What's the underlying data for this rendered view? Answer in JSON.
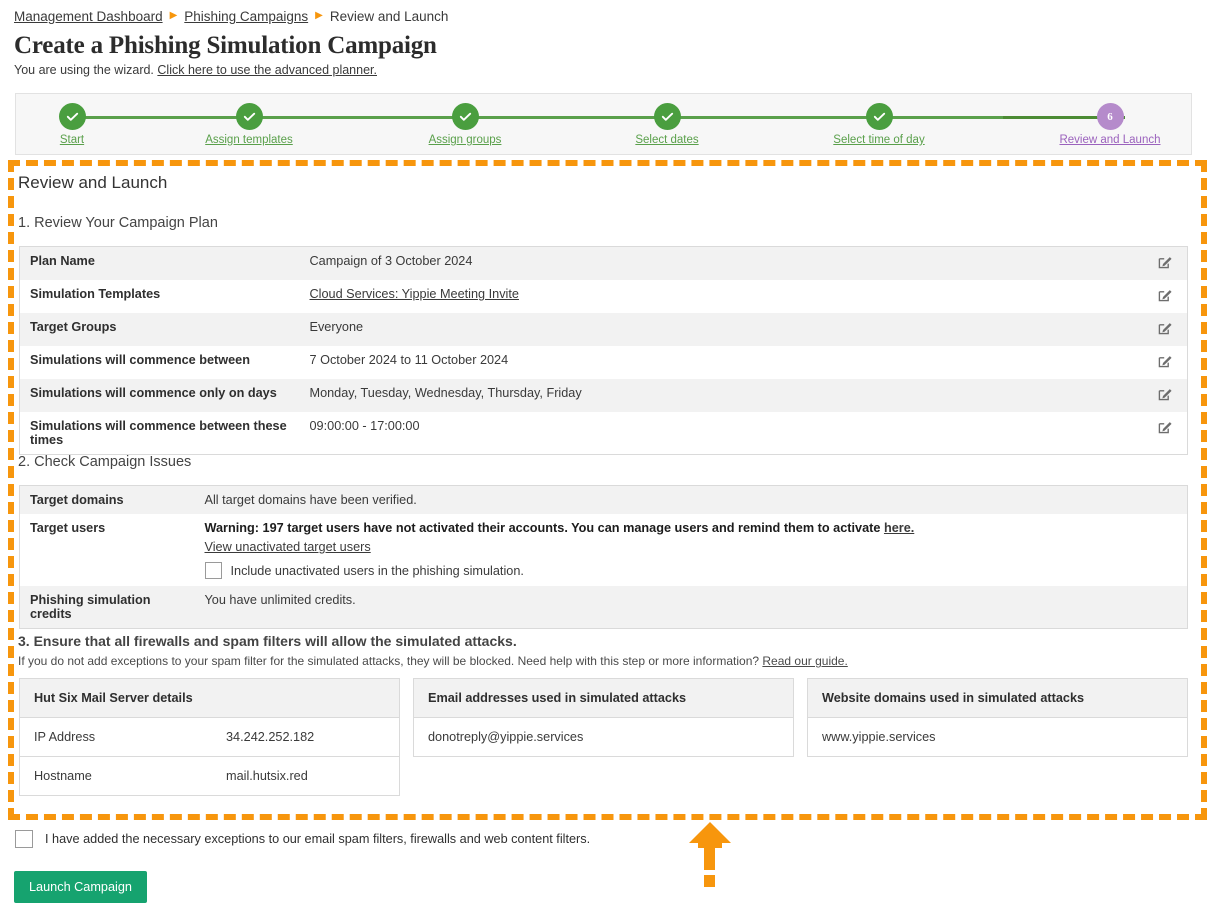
{
  "breadcrumb": {
    "items": [
      {
        "label": "Management Dashboard",
        "link": true
      },
      {
        "label": "Phishing Campaigns",
        "link": true
      },
      {
        "label": "Review and Launch",
        "link": false
      }
    ],
    "separator": "▶"
  },
  "header": {
    "title": "Create a Phishing Simulation Campaign",
    "subtitle_prefix": "You are using the wizard. ",
    "subtitle_link": "Click here to use the advanced planner."
  },
  "stepper": {
    "steps": [
      {
        "label": "Start",
        "state": "done",
        "marker": "✓"
      },
      {
        "label": "Assign templates",
        "state": "done",
        "marker": "✓"
      },
      {
        "label": "Assign groups",
        "state": "done",
        "marker": "✓"
      },
      {
        "label": "Select dates",
        "state": "done",
        "marker": "✓"
      },
      {
        "label": "Select time of day",
        "state": "done",
        "marker": "✓"
      },
      {
        "label": "Review and Launch",
        "state": "current",
        "marker": "6"
      }
    ],
    "done_color": "#4a9e3f",
    "current_color": "#b58bcb",
    "line_color": "#5aa04b"
  },
  "main": {
    "heading": "Review and Launch",
    "section1": {
      "title": "1. Review Your Campaign Plan",
      "rows": [
        {
          "label": "Plan Name",
          "value": "Campaign of 3 October 2024",
          "is_link": false,
          "edit_icon": "edit-pencil-icon"
        },
        {
          "label": "Simulation Templates",
          "value": "Cloud Services: Yippie Meeting Invite",
          "is_link": true,
          "edit_icon": "edit-pencil-icon"
        },
        {
          "label": "Target Groups",
          "value": "Everyone",
          "is_link": false,
          "edit_icon": "edit-pencil-icon"
        },
        {
          "label": "Simulations will commence between",
          "value": "7 October 2024 to 11 October 2024",
          "is_link": false,
          "edit_icon": "edit-pencil-icon"
        },
        {
          "label": "Simulations will commence only on days",
          "value": "Monday, Tuesday, Wednesday, Thursday, Friday",
          "is_link": false,
          "edit_icon": "edit-pencil-icon"
        },
        {
          "label": "Simulations will commence between these times",
          "value": "09:00:00 - 17:00:00",
          "is_link": false,
          "edit_icon": "edit-pencil-icon"
        }
      ]
    },
    "section2": {
      "title": "2. Check Campaign Issues",
      "domains_label": "Target domains",
      "domains_value": "All target domains have been verified.",
      "users_label": "Target users",
      "users_warning": "Warning: 197 target users have not activated their accounts. You can manage users and remind them to activate ",
      "users_warning_link": "here.",
      "view_unactivated_link": "View unactivated target users",
      "include_unactivated_label": "Include unactivated users in the phishing simulation.",
      "include_unactivated_checked": false,
      "credits_label": "Phishing simulation credits",
      "credits_value": "You have unlimited credits."
    },
    "section3": {
      "title": "3. Ensure that all firewalls and spam filters will allow the simulated attacks.",
      "note_prefix": "If you do not add exceptions to your spam filter for the simulated attacks, they will be blocked. Need help with this step or more information? ",
      "note_link": "Read our guide.",
      "cards": [
        {
          "heading": "Hut Six Mail Server details",
          "rows": [
            {
              "key": "IP Address",
              "value": "34.242.252.182"
            },
            {
              "key": "Hostname",
              "value": "mail.hutsix.red"
            }
          ]
        },
        {
          "heading": "Email addresses used in simulated attacks",
          "rows": [
            {
              "key": "donotreply@yippie.services",
              "value": ""
            }
          ]
        },
        {
          "heading": "Website domains used in simulated attacks",
          "rows": [
            {
              "key": "www.yippie.services",
              "value": ""
            }
          ]
        }
      ]
    }
  },
  "footer": {
    "confirm_label": "I have added the necessary exceptions to our email spam filters, firewalls and web content filters.",
    "confirm_checked": false,
    "launch_label": "Launch Campaign",
    "launch_color": "#16a36f"
  },
  "annotation": {
    "highlight_color": "#f7960d",
    "arrow_icon": "arrow-up-icon"
  }
}
